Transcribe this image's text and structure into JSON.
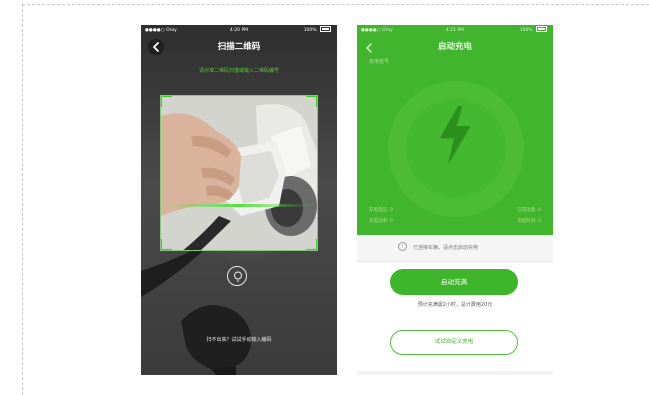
{
  "colors": {
    "accent_green": "#41b52d",
    "scan_green": "#3fcf2a",
    "dark_bg": "#3d3d3d"
  },
  "scan_screen": {
    "status": {
      "carrier": "●●●●○ Oroy",
      "time": "4:20 PM",
      "battery": "100%"
    },
    "title": "扫描二维码",
    "hint": "请对准二维码扫描或输入二维码编号",
    "manual_entry": "扫不出来？试试手动输入编码",
    "icons": {
      "back": "back-icon",
      "flashlight": "flashlight-icon"
    }
  },
  "charge_screen": {
    "status": {
      "carrier": "●●●●○ Oroy",
      "time": "4:21 PM",
      "battery": "100%"
    },
    "title": "启动充电",
    "charger_name": "充电桩号",
    "stats": {
      "voltage": "充电电压: 0",
      "power": "充电功率: 0",
      "energy": "已充电量: 0",
      "duration": "充电时间: 0"
    },
    "tip": "已连接车辆，请点击启动充电",
    "start_button": "启动充满",
    "estimate": "预计充满需2小时，总计费用20元",
    "secondary_button": "试试自定义充电",
    "icons": {
      "back": "back-icon",
      "bolt": "lightning-bolt-icon",
      "info": "info-icon"
    }
  }
}
